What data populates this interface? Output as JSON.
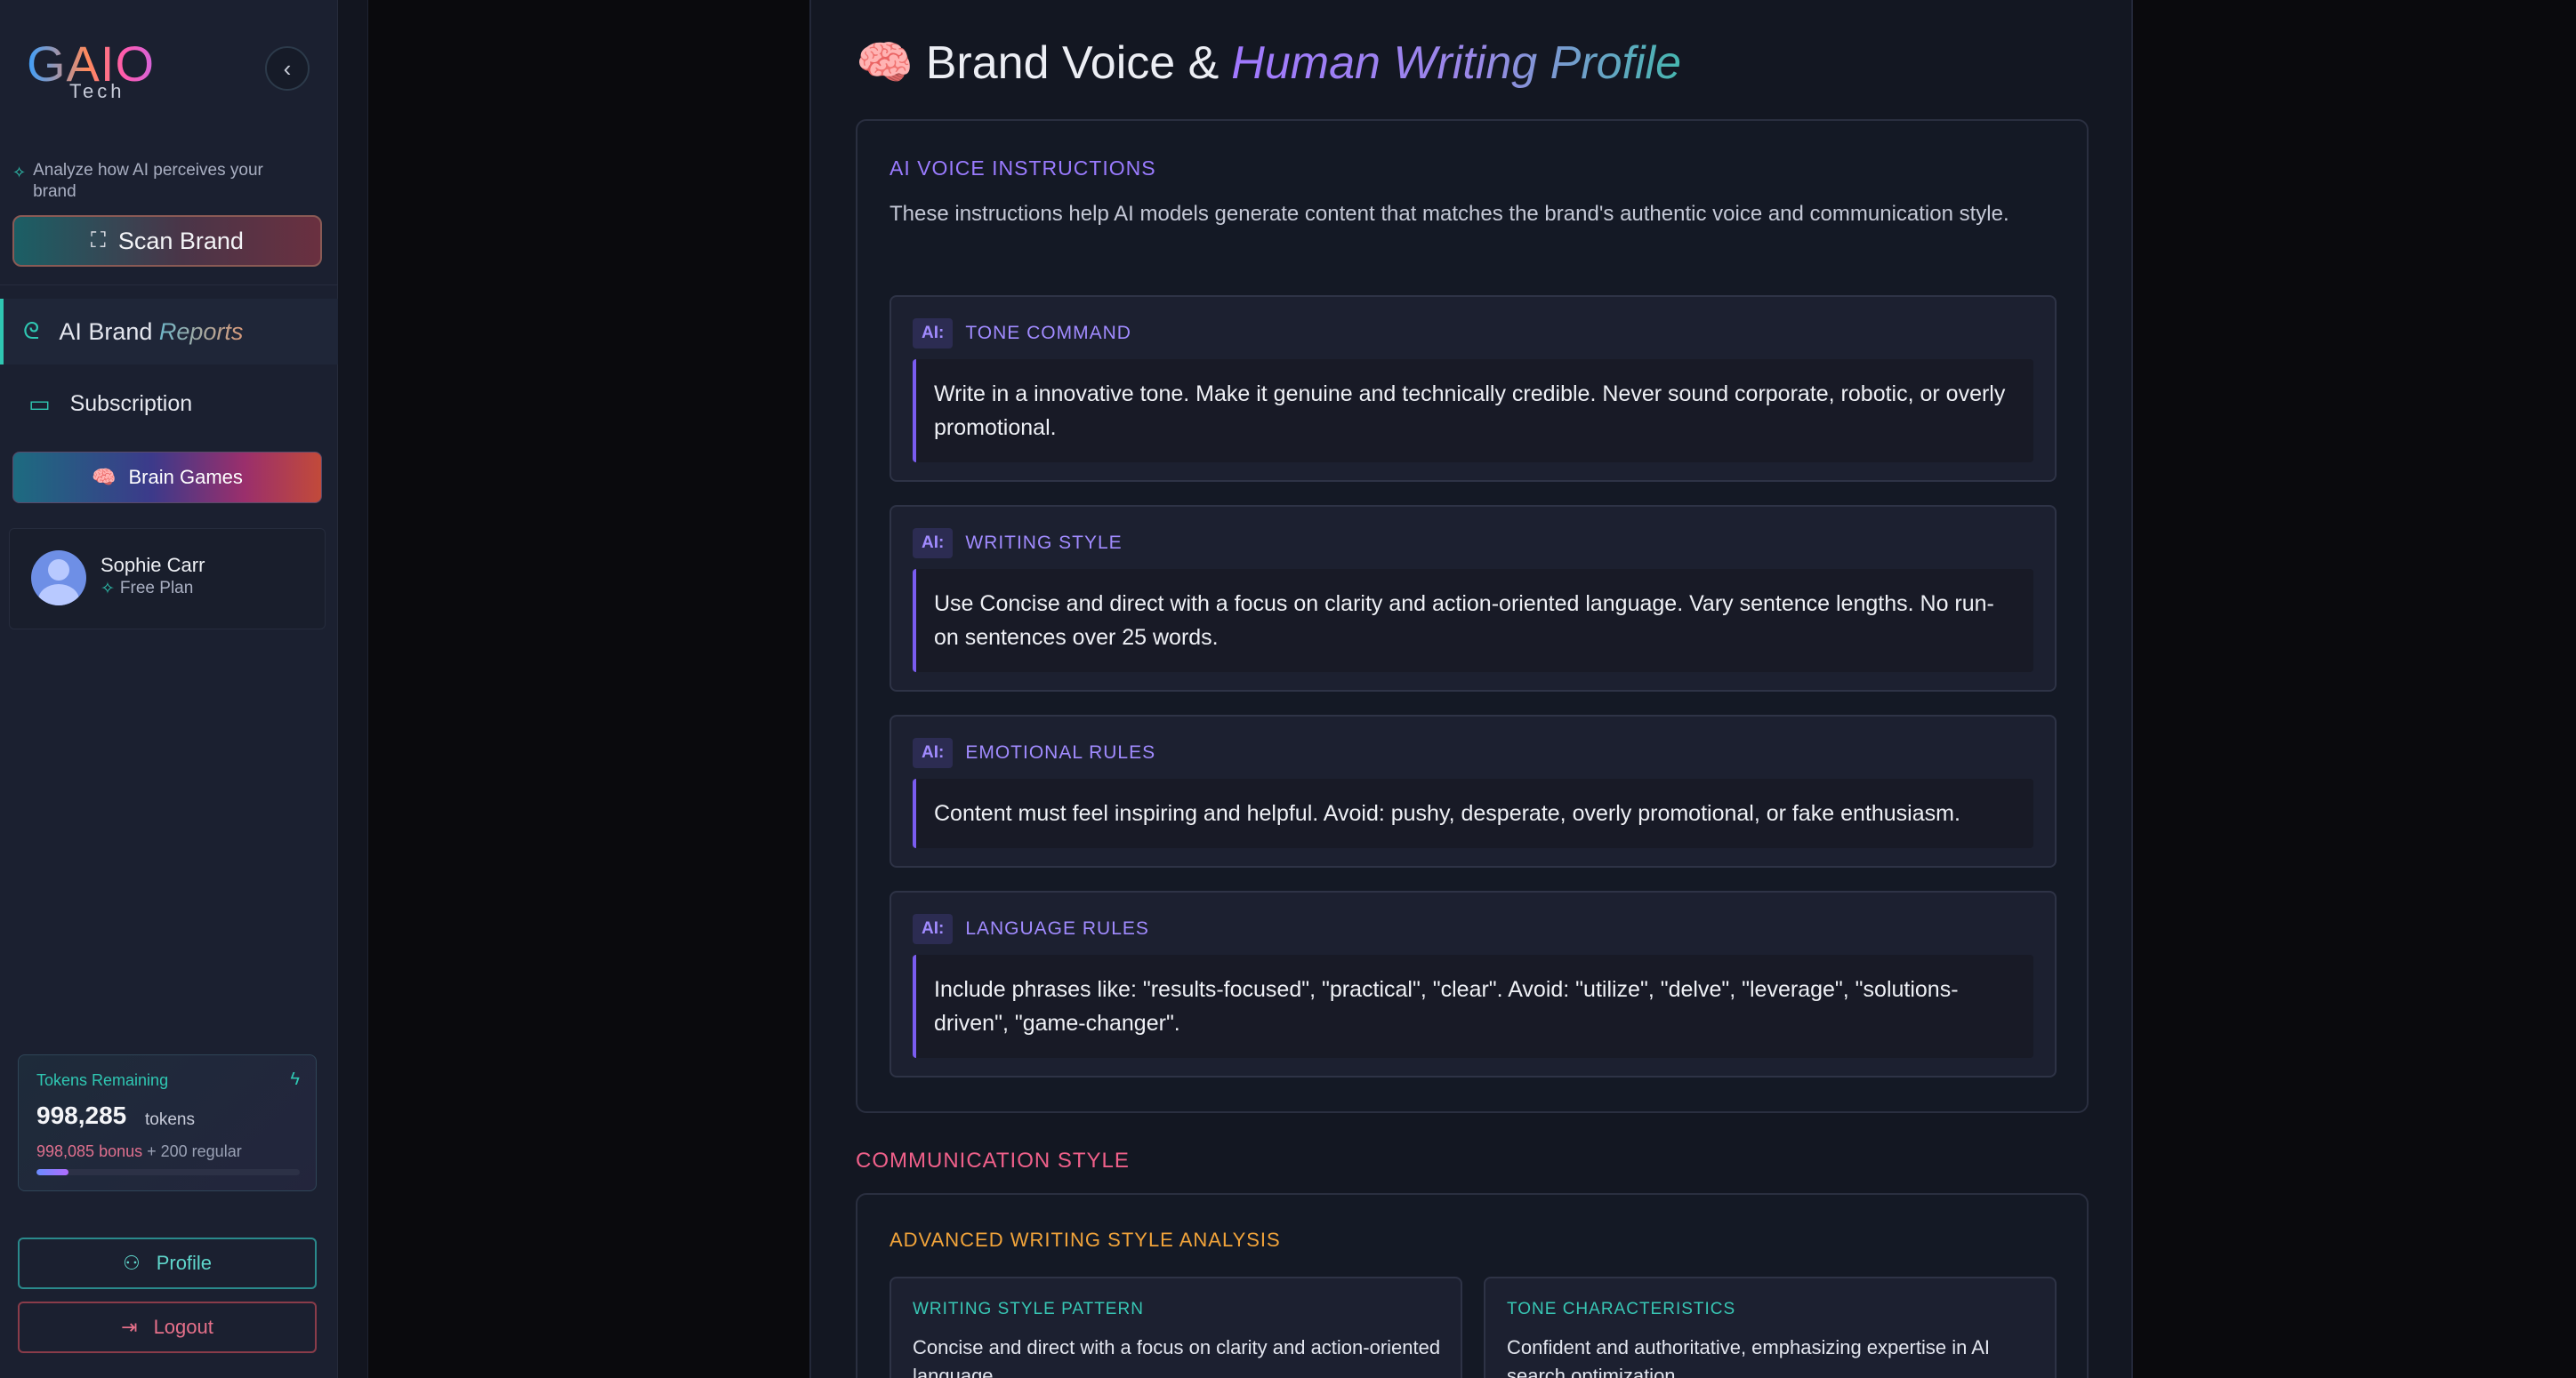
{
  "sidebar": {
    "logo_main": "GAIO",
    "logo_sub": "Tech",
    "collapse_icon": "chevron-left-icon",
    "hint": "Analyze how AI perceives your brand",
    "scan_button": "Scan Brand",
    "nav": {
      "reports_prefix": "AI Brand",
      "reports_suffix": "Reports",
      "subscription": "Subscription"
    },
    "brain_games": "Brain Games",
    "user": {
      "name": "Sophie Carr",
      "plan": "Free Plan"
    },
    "tokens": {
      "label": "Tokens Remaining",
      "count": "998,285",
      "unit": "tokens",
      "bonus": "998,085 bonus",
      "regular": "+ 200 regular",
      "progress_fraction": 0.12
    },
    "profile_button": "Profile",
    "logout_button": "Logout"
  },
  "main": {
    "title_prefix": "Brand Voice &",
    "title_highlight": "Human Writing Profile",
    "ai_section": {
      "label": "AI VOICE INSTRUCTIONS",
      "description": "These instructions help AI models generate content that matches the brand's authentic voice and communication style.",
      "badge": "AI:",
      "rules": [
        {
          "title": "TONE COMMAND",
          "body": "Write in a innovative tone. Make it genuine and technically credible. Never sound corporate, robotic, or overly promotional."
        },
        {
          "title": "WRITING STYLE",
          "body": "Use Concise and direct with a focus on clarity and action-oriented language. Vary sentence lengths. No run-on sentences over 25 words."
        },
        {
          "title": "EMOTIONAL RULES",
          "body": "Content must feel inspiring and helpful. Avoid: pushy, desperate, overly promotional, or fake enthusiasm."
        },
        {
          "title": "LANGUAGE RULES",
          "body": "Include phrases like: \"results-focused\", \"practical\", \"clear\". Avoid: \"utilize\", \"delve\", \"leverage\", \"solutions-driven\", \"game-changer\"."
        }
      ]
    },
    "communication_style": {
      "title": "COMMUNICATION STYLE",
      "advanced_label": "ADVANCED WRITING STYLE ANALYSIS",
      "pattern_title": "WRITING STYLE PATTERN",
      "pattern_value": "Concise and direct with a focus on clarity and action-oriented language.",
      "tone_title": "TONE CHARACTERISTICS",
      "tone_value": "Confident and authoritative, emphasizing expertise in AI search optimization."
    }
  },
  "colors": {
    "accent_teal": "#2fc7b2",
    "accent_purple": "#9a7bff",
    "accent_pink": "#f0608a",
    "accent_orange": "#f2a43a"
  }
}
